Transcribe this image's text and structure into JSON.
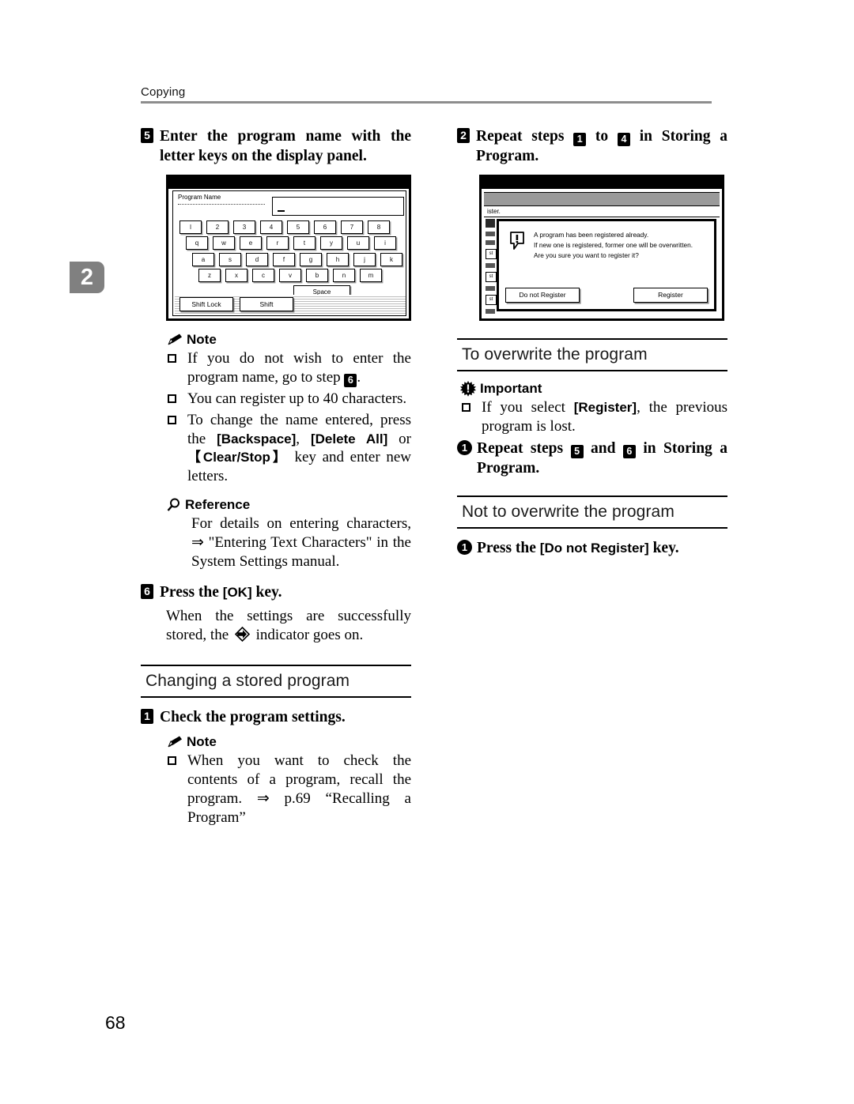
{
  "header": {
    "title": "Copying",
    "chapter_tab": "2"
  },
  "page_number": "68",
  "left_column": {
    "step5": {
      "number": "5",
      "text": "Enter the program name with the letter keys on the display panel."
    },
    "keyboard_figure": {
      "title": "Program Name",
      "field_value": "",
      "row1": [
        "l",
        "2",
        "3",
        "4",
        "5",
        "6",
        "7",
        "8"
      ],
      "row2": [
        "q",
        "w",
        "e",
        "r",
        "t",
        "y",
        "u",
        "i"
      ],
      "row3": [
        "a",
        "s",
        "d",
        "f",
        "g",
        "h",
        "j",
        "k"
      ],
      "row4": [
        "z",
        "x",
        "c",
        "v",
        "b",
        "n",
        "m"
      ],
      "space_key": "Space",
      "shift_lock_key": "Shift Lock",
      "shift_key": "Shift"
    },
    "note": {
      "label": "Note",
      "icon": "pencil-icon",
      "items": [
        {
          "pre": "If you do not wish to enter the program name, go to step ",
          "marker": "6",
          "post": "."
        },
        {
          "pre": "You can register up to 40 characters.",
          "marker": "",
          "post": ""
        }
      ],
      "item3": {
        "t1": "To change the name entered, press the ",
        "k1": "[Backspace]",
        "t2": ", ",
        "k2": "[Delete All]",
        "t3": " or ",
        "k3": "【Clear/Stop】",
        "t4": " key and enter new letters."
      }
    },
    "reference": {
      "label": "Reference",
      "icon": "magnifier-icon",
      "body": "For details on entering characters, ⇒ \"Entering Text Characters\" in the System Settings manual."
    },
    "step6": {
      "number": "6",
      "title_pre": "Press the ",
      "title_key": "[OK]",
      "title_post": " key.",
      "body_pre": "When the settings are successfully stored, the ",
      "body_post": " indicator goes on."
    },
    "changing_section": {
      "title": "Changing a stored program",
      "step1": {
        "number": "1",
        "text": "Check the program settings."
      },
      "note": {
        "label": "Note",
        "icon": "pencil-icon",
        "item": "When you want to check the contents of a program, recall the program. ⇒ p.69 “Recalling a Program”"
      }
    }
  },
  "right_column": {
    "step2": {
      "number": "2",
      "t1": "Repeat steps ",
      "m1": "1",
      "t2": " to ",
      "m2": "4",
      "t3": " in Storing a Program."
    },
    "dialog_figure": {
      "background_text": "ister.",
      "sidebar_labels": [
        "st",
        "st",
        "st"
      ],
      "icon": "exclamation-icon",
      "message_lines": [
        "A program has been registered already.",
        "If new one is registered, former one will be overwritten.",
        "Are you sure you want to register it?"
      ],
      "button_left": "Do not Register",
      "button_right": "Register"
    },
    "overwrite_section": {
      "title": "To overwrite the program",
      "important": {
        "label": "Important",
        "icon": "starburst-exclamation-icon",
        "item_pre": "If you select ",
        "item_key": "[Register]",
        "item_post": ", the previous program is lost."
      },
      "step1": {
        "number": "1",
        "t1": "Repeat steps ",
        "m1": "5",
        "t2": " and ",
        "m2": "6",
        "t3": " in Storing a Program."
      }
    },
    "not_overwrite_section": {
      "title": "Not to overwrite the program",
      "step1": {
        "number": "1",
        "t1": "Press the ",
        "k1": "[Do not Register]",
        "t2": " key."
      }
    }
  }
}
